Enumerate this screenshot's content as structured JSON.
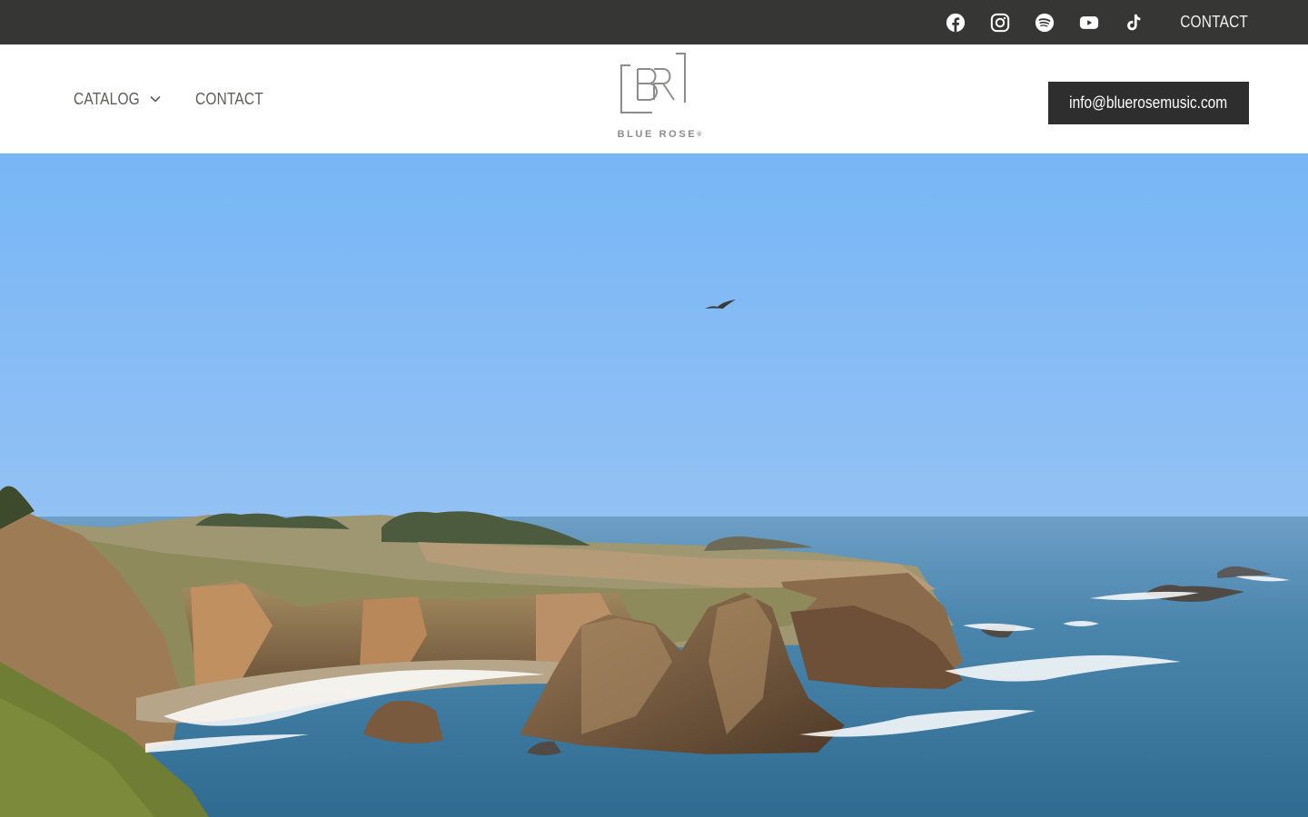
{
  "topbar": {
    "social_icons": [
      "facebook-icon",
      "instagram-icon",
      "spotify-icon",
      "youtube-icon",
      "tiktok-icon"
    ],
    "contact_label": "CONTACT"
  },
  "header": {
    "nav": {
      "catalog_label": "CATALOG",
      "contact_label": "CONTACT"
    },
    "logo": {
      "monogram": "BR",
      "brand_name": "BLUE ROSE",
      "registered": "®"
    },
    "email_button_label": "info@bluerosemusic.com"
  },
  "hero": {
    "image": "coastal-cliffs-ocean-photo"
  },
  "colors": {
    "topbar_bg": "#363735",
    "button_bg": "#2e2e2e",
    "nav_text": "#5d5d5a",
    "sky": "#7fb8f2",
    "ocean": "#3e7aa0"
  }
}
